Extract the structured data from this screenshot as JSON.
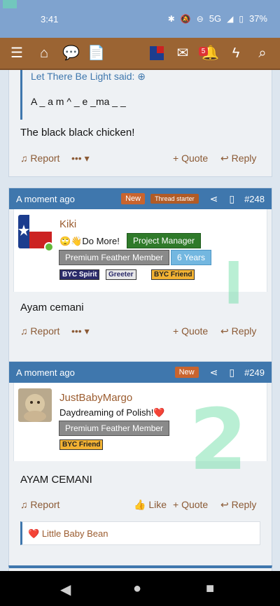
{
  "status": {
    "time": "3:41",
    "network": "5G",
    "battery": "37%",
    "icons": [
      "bluetooth-icon",
      "mute-icon",
      "do-not-disturb-icon",
      "signal-icon",
      "battery-icon"
    ]
  },
  "navbar": {
    "icons": [
      "menu-icon",
      "home-icon",
      "chat-icon",
      "document-icon",
      "avatar",
      "mail-icon",
      "bell-icon",
      "bolt-icon",
      "search-icon"
    ],
    "alert_count": "5"
  },
  "post_prev": {
    "quote_attribution": "Let There Be Light said:",
    "quote_text": "A _ a m ^ _ e _ma _ _",
    "message": "The black black chicken!",
    "report": "Report",
    "quote": "Quote",
    "reply": "Reply"
  },
  "post_248": {
    "time": "A moment ago",
    "new_tag": "New",
    "starter_tag": "Thread starter",
    "number": "#248",
    "username": "Kiki",
    "user_title": "Do More!",
    "banners": [
      "Project Manager",
      "Premium Feather Member",
      "6 Years"
    ],
    "mini_badges": [
      "BYC Spirit",
      "Greeter",
      "BYC Friend"
    ],
    "message": "Ayam cemani",
    "report": "Report",
    "quote": "Quote",
    "reply": "Reply"
  },
  "post_249": {
    "time": "A moment ago",
    "new_tag": "New",
    "number": "#249",
    "username": "JustBabyMargo",
    "user_title": "Daydreaming of Polish!❤️",
    "banners": [
      "Premium Feather Member"
    ],
    "mini_badges": [
      "BYC Friend"
    ],
    "message": "AYAM CEMANI",
    "report": "Report",
    "like": "Like",
    "quote": "Quote",
    "reply": "Reply",
    "signature": "Little Baby Bean"
  },
  "colors": {
    "header_blue": "#3f77ad",
    "nav_brown": "#9b6433",
    "accent_orange": "#c9642e",
    "link_brown": "#8b5a35"
  }
}
